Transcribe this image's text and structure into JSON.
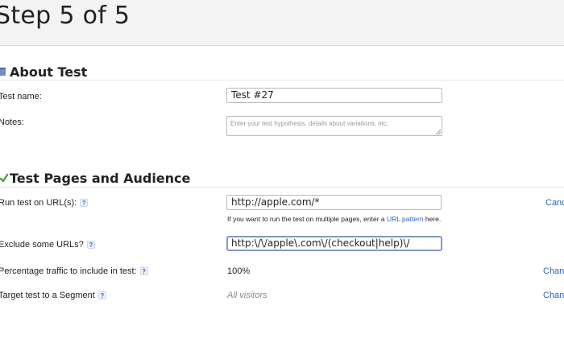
{
  "header": {
    "title": "Step 5 of 5"
  },
  "about_section": {
    "title": "About Test",
    "icon": "folder-icon",
    "test_name_label": "Test name:",
    "test_name_value": "Test #27",
    "notes_label": "Notes:",
    "notes_placeholder": "Enter your test hypothesis, details about variations, etc."
  },
  "audience_section": {
    "title": "Test Pages and Audience",
    "icon": "checkmark-icon",
    "run_on_label": "Run test on URL(s):",
    "run_on_value": "http://apple.com/*",
    "run_on_side_link": "Canc",
    "hint_prefix": "If you want to run the test on multiple pages, enter a",
    "hint_link": "URL pattern",
    "hint_suffix": "here.",
    "exclude_label": "Exclude some URLs?",
    "exclude_value": "http:\\/\\/apple\\.com\\/(checkout|help)\\/",
    "traffic_label": "Percentage traffic to include in test:",
    "traffic_value": "100%",
    "traffic_side_link": "Chan",
    "segment_label": "Target test to a Segment",
    "segment_value": "All visitors",
    "segment_side_link": "Chan"
  },
  "help_glyph": "?",
  "colors": {
    "link": "#2a63b8",
    "section_icon_blue": "#6e8fc6",
    "check_green": "#4aa33a"
  }
}
